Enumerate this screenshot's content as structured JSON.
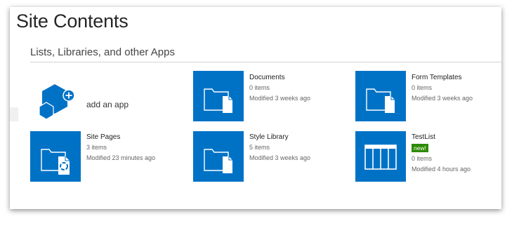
{
  "page_title": "Site Contents",
  "section_header": "Lists, Libraries, and other Apps",
  "add_app": {
    "label": "add an app"
  },
  "apps": [
    {
      "title": "Documents",
      "count": "0 items",
      "modified": "Modified 3 weeks ago",
      "icon": "document-library-icon"
    },
    {
      "title": "Form Templates",
      "count": "0 items",
      "modified": "Modified 3 weeks ago",
      "icon": "document-library-icon"
    },
    {
      "title": "Site Pages",
      "count": "3 items",
      "modified": "Modified 23 minutes ago",
      "icon": "site-pages-library-icon"
    },
    {
      "title": "Style Library",
      "count": "5 items",
      "modified": "Modified 3 weeks ago",
      "icon": "document-library-icon"
    },
    {
      "title": "TestList",
      "badge": "new!",
      "count": "0 items",
      "modified": "Modified 4 hours ago",
      "icon": "custom-list-icon"
    }
  ],
  "colors": {
    "tile": "#0072c6",
    "badge": "#2b8a00",
    "text": "#444444"
  }
}
